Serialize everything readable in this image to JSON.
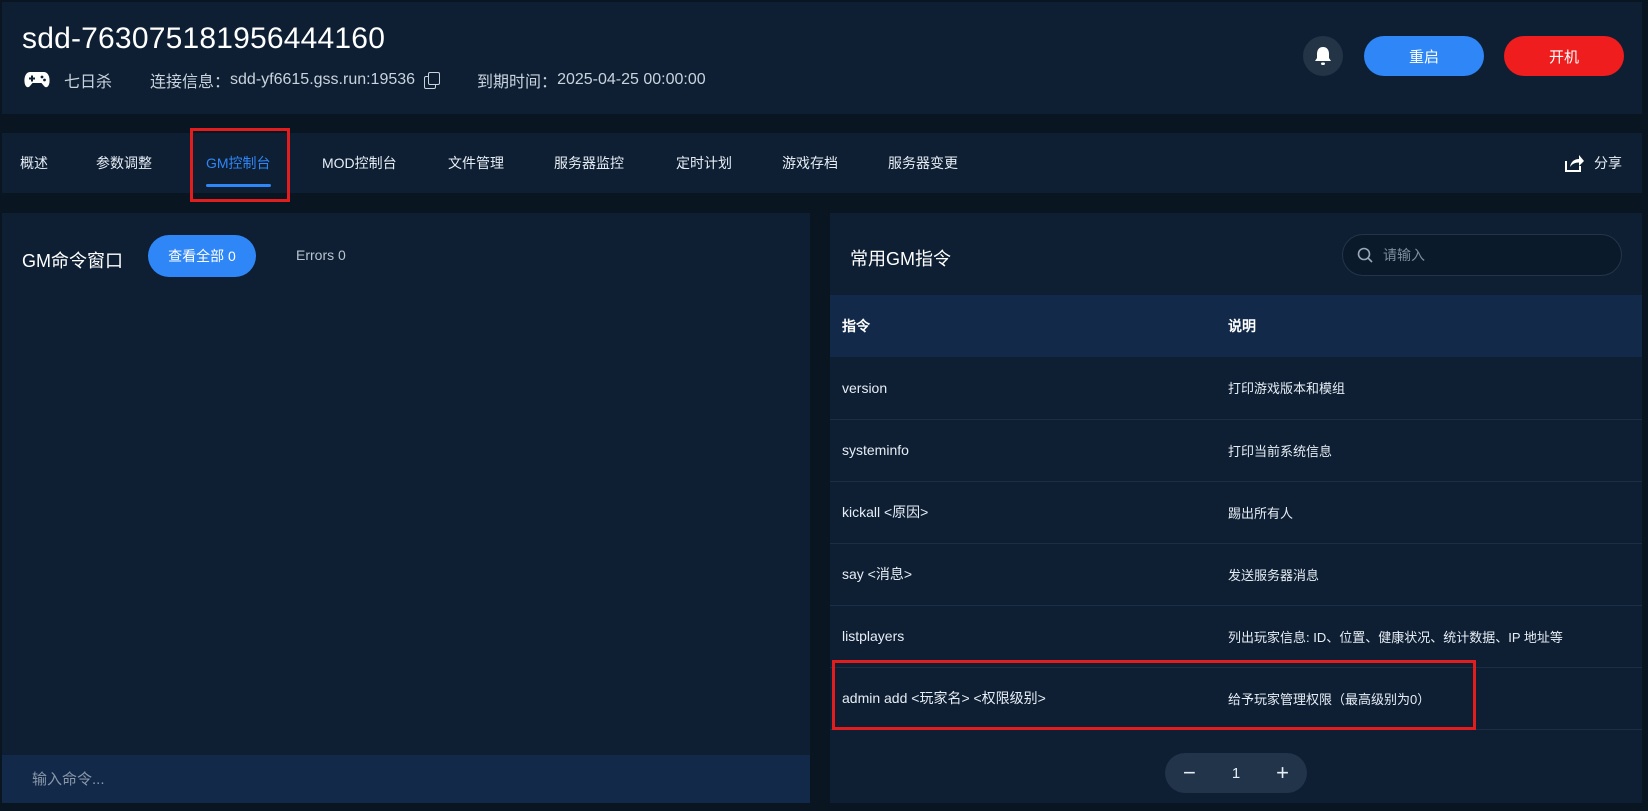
{
  "header": {
    "server_id": "sdd-763075181956444160",
    "game_name": "七日杀",
    "connection_label": "连接信息：",
    "connection_value": "sdd-yf6615.gss.run:19536",
    "expiry_label": "到期时间：",
    "expiry_value": "2025-04-25 00:00:00",
    "restart_label": "重启",
    "start_label": "开机"
  },
  "tabs": [
    {
      "label": "概述"
    },
    {
      "label": "参数调整"
    },
    {
      "label": "GM控制台"
    },
    {
      "label": "MOD控制台"
    },
    {
      "label": "文件管理"
    },
    {
      "label": "服务器监控"
    },
    {
      "label": "定时计划"
    },
    {
      "label": "游戏存档"
    },
    {
      "label": "服务器变更"
    }
  ],
  "active_tab": "GM控制台",
  "share_label": "分享",
  "gm_panel": {
    "title": "GM命令窗口",
    "view_all_label": "查看全部 0",
    "errors_label": "Errors 0",
    "input_placeholder": "输入命令..."
  },
  "commands_panel": {
    "title": "常用GM指令",
    "search_placeholder": "请输入",
    "columns": [
      "指令",
      "说明"
    ],
    "rows": [
      {
        "command": "version",
        "desc": "打印游戏版本和模组"
      },
      {
        "command": "systeminfo",
        "desc": "打印当前系统信息"
      },
      {
        "command": "kickall <原因>",
        "desc": "踢出所有人"
      },
      {
        "command": "say <消息>",
        "desc": "发送服务器消息"
      },
      {
        "command": "listplayers",
        "desc": "列出玩家信息: ID、位置、健康状况、统计数据、IP 地址等"
      },
      {
        "command": "admin add <玩家名> <权限级别>",
        "desc": "给予玩家管理权限（最高级别为0）"
      }
    ],
    "pager": {
      "minus": "−",
      "page": "1",
      "plus": "+"
    }
  },
  "colors": {
    "accent": "#2f86f6",
    "danger": "#ef1d1d",
    "panel": "#0e1f33",
    "background": "#0a1522",
    "highlight": "#e11d1d"
  }
}
